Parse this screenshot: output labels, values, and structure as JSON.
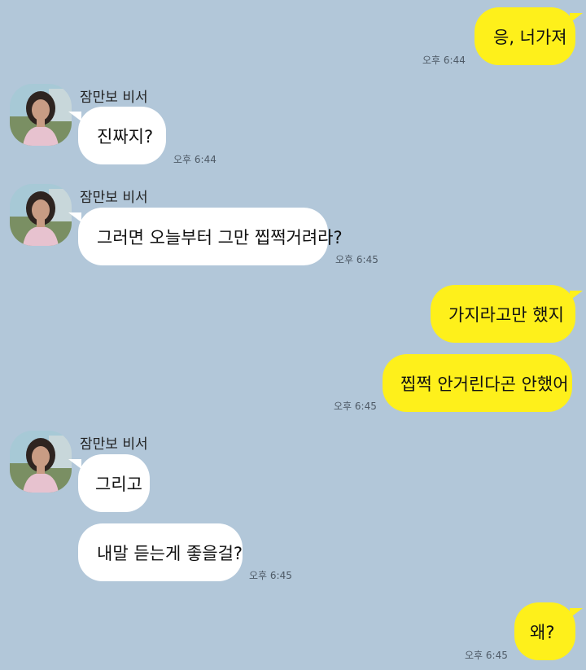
{
  "contact": {
    "name": "잠만보 비서"
  },
  "colors": {
    "background": "#b2c7d9",
    "my_bubble": "#fef01b",
    "their_bubble": "#ffffff"
  },
  "messages": [
    {
      "sender": "me",
      "text": "응, 너가져",
      "time": "오후 6:44"
    },
    {
      "sender": "them",
      "name": "잠만보 비서",
      "text": "진짜지?",
      "time": "오후 6:44"
    },
    {
      "sender": "them",
      "name": "잠만보 비서",
      "text": "그러면 오늘부터 그만 찝쩍거려라?",
      "time": "오후 6:45"
    },
    {
      "sender": "me",
      "text": "가지라고만 했지"
    },
    {
      "sender": "me",
      "text": "찝쩍 안거린다곤 안했어",
      "time": "오후 6:45"
    },
    {
      "sender": "them",
      "name": "잠만보 비서",
      "text": "그리고"
    },
    {
      "sender": "them",
      "text": "내말 듣는게 좋을걸?",
      "time": "오후 6:45"
    },
    {
      "sender": "me",
      "text": "왜?",
      "time": "오후 6:45"
    }
  ]
}
